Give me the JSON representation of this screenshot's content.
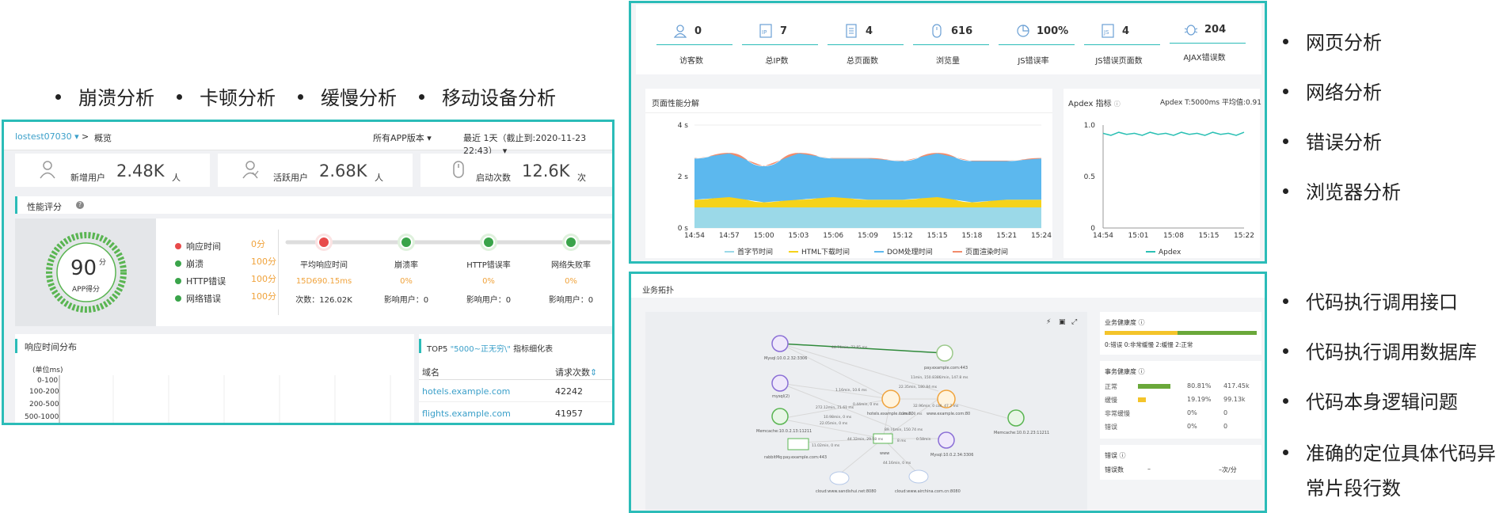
{
  "top_bullets": [
    "崩溃分析",
    "卡顿分析",
    "缓慢分析",
    "移动设备分析"
  ],
  "right_bullets_top": [
    "网页分析",
    "网络分析",
    "错误分析",
    "浏览器分析"
  ],
  "right_bullets_bottom": [
    "代码执行调用接口",
    "代码执行调用数据库",
    "代码本身逻辑问题",
    "准确的定位具体代码异",
    "常片段行数"
  ],
  "app": {
    "app_name": "lostest07030",
    "crumb_sep": ">",
    "crumb": "概览",
    "version": "所有APP版本",
    "range": "最近 1天（截止到:2020-11-23 22:43）",
    "kpis": [
      {
        "icon": "user-icon",
        "label": "新增用户",
        "value": "2.48K",
        "unit": "人"
      },
      {
        "icon": "active-user-icon",
        "label": "活跃用户",
        "value": "2.68K",
        "unit": "人"
      },
      {
        "icon": "mouse-icon",
        "label": "启动次数",
        "value": "12.6K",
        "unit": "次"
      }
    ],
    "perf_title": "性能评分",
    "score": "90",
    "score_unit": "分",
    "score_label": "APP得分",
    "factors": [
      {
        "name": "响应时间",
        "score": "0",
        "unit": "分",
        "color": "#e84a4a"
      },
      {
        "name": "崩溃",
        "score": "100",
        "unit": "分",
        "color": "#3aa44a"
      },
      {
        "name": "HTTP错误",
        "score": "100",
        "unit": "分",
        "color": "#3aa44a"
      },
      {
        "name": "网络错误",
        "score": "100",
        "unit": "分",
        "color": "#3aa44a"
      }
    ],
    "stats": [
      {
        "title": "平均响应时间",
        "value": "15D690.15ms",
        "sub": "次数：126.02K"
      },
      {
        "title": "崩溃率",
        "value": "0%",
        "sub": "影响用户：0"
      },
      {
        "title": "HTTP错误率",
        "value": "0%",
        "sub": "影响用户：0"
      },
      {
        "title": "网络失败率",
        "value": "0%",
        "sub": "影响用户：0"
      }
    ],
    "resp_title": "响应时间分布",
    "resp_unit": "(单位ms)",
    "resp_rows": [
      "0-100",
      "100-200",
      "200-500",
      "500-1000"
    ],
    "top5_title_a": "TOP5",
    "top5_title_b": "\"5000~正无穷\\\"",
    "top5_title_c": "指标细化表",
    "top5_cols": [
      "域名",
      "请求次数"
    ],
    "top5_rows": [
      {
        "domain": "hotels.example.com",
        "count": "42242"
      },
      {
        "domain": "flights.example.com",
        "count": "41957"
      }
    ]
  },
  "web": {
    "metrics": [
      {
        "icon": "visitor-icon",
        "value": "0",
        "label": "访客数"
      },
      {
        "icon": "ip-icon",
        "value": "7",
        "label": "总IP数"
      },
      {
        "icon": "page-icon",
        "value": "4",
        "label": "总页面数"
      },
      {
        "icon": "mouse-icon",
        "value": "616",
        "label": "浏览量"
      },
      {
        "icon": "pie-icon",
        "value": "100%",
        "label": "JS错误率"
      },
      {
        "icon": "js-icon",
        "value": "4",
        "label": "JS错误页面数"
      },
      {
        "icon": "bug-icon",
        "value": "204",
        "label": "AJAX错误数"
      }
    ],
    "perf_title": "页面性能分解",
    "apdex_title": "Apdex 指标",
    "apdex_info": "Apdex T:5000ms 平均值:0.91"
  },
  "chart_data": [
    {
      "type": "area",
      "title": "页面性能分解",
      "x": [
        "14:54",
        "14:57",
        "15:00",
        "15:03",
        "15:06",
        "15:09",
        "15:12",
        "15:15",
        "15:18",
        "15:21",
        "15:24"
      ],
      "y_ticks": [
        "0 s",
        "2 s",
        "4 s"
      ],
      "ylim": [
        0,
        4
      ],
      "series": [
        {
          "name": "首字节时间",
          "color": "#9bd9e8",
          "values": [
            0.8,
            0.8,
            0.8,
            0.8,
            0.8,
            0.8,
            0.8,
            0.8,
            0.8,
            0.8,
            0.8
          ]
        },
        {
          "name": "HTML下载时间",
          "color": "#f5d21a",
          "values": [
            0.3,
            0.4,
            0.2,
            0.3,
            0.4,
            0.3,
            0.3,
            0.4,
            0.2,
            0.3,
            0.3
          ]
        },
        {
          "name": "DOM处理时间",
          "color": "#5cb8ee",
          "values": [
            1.6,
            1.7,
            1.4,
            1.8,
            1.5,
            1.6,
            1.5,
            1.7,
            1.6,
            1.5,
            1.6
          ]
        },
        {
          "name": "页面渲染时间",
          "color": "#f28b6b",
          "values": [
            0.02,
            0.02,
            0.02,
            0.02,
            0.02,
            0.02,
            0.02,
            0.02,
            0.02,
            0.02,
            0.02
          ]
        }
      ],
      "legend": "bottom"
    },
    {
      "type": "line",
      "title": "Apdex 指标",
      "x": [
        "14:54",
        "15:01",
        "15:08",
        "15:15",
        "15:22"
      ],
      "y_ticks": [
        "0",
        "0.5",
        "1.0"
      ],
      "ylim": [
        0,
        1
      ],
      "series": [
        {
          "name": "Apdex",
          "color": "#2bc0b4",
          "values": [
            0.92,
            0.9,
            0.93,
            0.91,
            0.92,
            0.9,
            0.93,
            0.91,
            0.92,
            0.9,
            0.93,
            0.91,
            0.92,
            0.9,
            0.93,
            0.91,
            0.92,
            0.9,
            0.93
          ]
        }
      ],
      "legend": "bottom"
    }
  ],
  "topo": {
    "title": "业务拓扑",
    "nodes": [
      {
        "label": "Mysql:10.0.2.32:3306",
        "kind": "db"
      },
      {
        "label": "pay.example.com:443",
        "kind": "app"
      },
      {
        "label": "mysql(2)",
        "kind": "db"
      },
      {
        "label": "hotels.example.com:80",
        "kind": "app"
      },
      {
        "label": "www.example.com:80",
        "kind": "app"
      },
      {
        "label": "Memcache:10.0.2.13:11211",
        "kind": "cache"
      },
      {
        "label": "Memcache:10.0.2.23:11211",
        "kind": "cache"
      },
      {
        "label": "rabbitMq:pay.example.com:443",
        "kind": "mq"
      },
      {
        "label": "www",
        "kind": "svc"
      },
      {
        "label": "Mysql:10.0.2.34:3306",
        "kind": "db"
      },
      {
        "label": "cloud:www.sandishui.net:8080",
        "kind": "cloud"
      },
      {
        "label": "cloud:www.airchina.com.cn:8080",
        "kind": "cloud"
      }
    ],
    "edge_labels": [
      "44.74min, 73.85 ms",
      "11min, 150.8386/min, 147.8 ms",
      "1.16min, 10.6 ms",
      "22.35min, 180.84 ms",
      "32.96min, 0 call, 47.7 ms",
      "272.12min, 71.61 ms",
      "0.44min, 0 ms",
      "10.98min, 0 ms",
      "22.05min, 0 ms",
      "0.3min, 0 ms",
      "89.74min, 150.74 ms",
      "44.32min, 29.58 ms",
      "0.58min",
      "11.02min, 0 ms",
      "44.16min, 0 ms",
      "8 ms"
    ],
    "biz_health_title": "业务健康度",
    "biz_legend": [
      "0:错误",
      "0:非常缓慢",
      "2:缓慢",
      "2:正常"
    ],
    "tx_title": "事务健康度",
    "tx_rows": [
      {
        "name": "正常",
        "pct": "80.81%",
        "count": "417.45k",
        "fill": 0.81,
        "color": "#6aa83a"
      },
      {
        "name": "缓慢",
        "pct": "19.19%",
        "count": "99.13k",
        "fill": 0.19,
        "color": "#f4c42a"
      },
      {
        "name": "非常缓慢",
        "pct": "0%",
        "count": "0",
        "fill": 0,
        "color": "#f08a3a"
      },
      {
        "name": "错误",
        "pct": "0%",
        "count": "0",
        "fill": 0,
        "color": "#e84a4a"
      }
    ],
    "err_title": "错误",
    "err_label": "错误数",
    "err_value": "–",
    "err_rate": "–次/分"
  }
}
